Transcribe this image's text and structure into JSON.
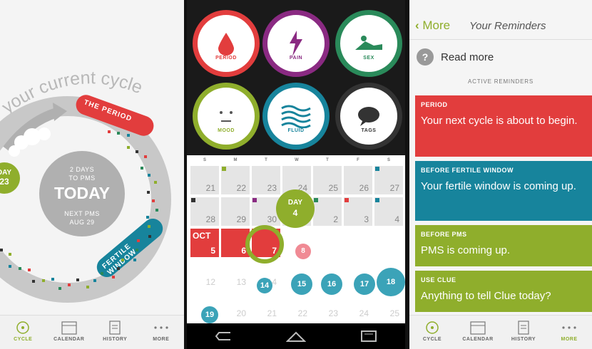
{
  "panel1": {
    "cycle_title": "your current cycle",
    "period_label": "THE PERIOD",
    "fertile_label": "FERTILE WINDOW",
    "day_bubble": {
      "line1": "DAY",
      "line2": "23"
    },
    "days_to_pms": "2 DAYS\nTO PMS",
    "today": "TODAY",
    "next_pms": "NEXT PMS\nAUG 29"
  },
  "tabs": [
    {
      "label": "CYCLE",
      "icon": "cycle-icon"
    },
    {
      "label": "CALENDAR",
      "icon": "calendar-icon"
    },
    {
      "label": "HISTORY",
      "icon": "history-icon"
    },
    {
      "label": "MORE",
      "icon": "more-icon"
    }
  ],
  "panel2": {
    "categories": [
      {
        "label": "PERIOD",
        "color": "#e23d3d",
        "icon": "drop-icon"
      },
      {
        "label": "PAIN",
        "color": "#8a2a82",
        "icon": "lightning-icon"
      },
      {
        "label": "SEX",
        "color": "#2a8a5a",
        "icon": "sex-icon"
      },
      {
        "label": "MOOD",
        "color": "#8fae2c",
        "icon": "face-icon"
      },
      {
        "label": "FLUID",
        "color": "#17849c",
        "icon": "waves-icon"
      },
      {
        "label": "TAGS",
        "color": "#333333",
        "icon": "speech-bubble-icon"
      }
    ],
    "weekdays": [
      "S",
      "M",
      "T",
      "W",
      "T",
      "F",
      "S"
    ],
    "month_label": "OCT",
    "day_balloon": {
      "line1": "DAY",
      "line2": "4"
    },
    "row1": [
      "21",
      "22",
      "23",
      "24",
      "25",
      "26",
      "27"
    ],
    "row2": [
      "28",
      "29",
      "30",
      "",
      "2",
      "3",
      "4"
    ],
    "row3": [
      "5",
      "6",
      "7",
      "8",
      "",
      "",
      ""
    ],
    "row4": [
      "12",
      "13",
      "14",
      "15",
      "16",
      "17",
      "18"
    ],
    "row5": [
      "19",
      "20",
      "21",
      "22",
      "23",
      "24",
      "25"
    ]
  },
  "panel3": {
    "back_label": "More",
    "title": "Your Reminders",
    "read_more": "Read more",
    "active_label": "ACTIVE REMINDERS",
    "reminders": [
      {
        "heading": "PERIOD",
        "body": "Your next cycle is about to begin.",
        "color": "#e23d3d"
      },
      {
        "heading": "BEFORE FERTILE WINDOW",
        "body": "Your fertile window is coming up.",
        "color": "#17849c"
      },
      {
        "heading": "BEFORE PMS",
        "body": "PMS is coming up.",
        "color": "#8fae2c"
      },
      {
        "heading": "USE CLUE",
        "body": "Anything to tell Clue today?",
        "color": "#8fae2c"
      }
    ]
  }
}
